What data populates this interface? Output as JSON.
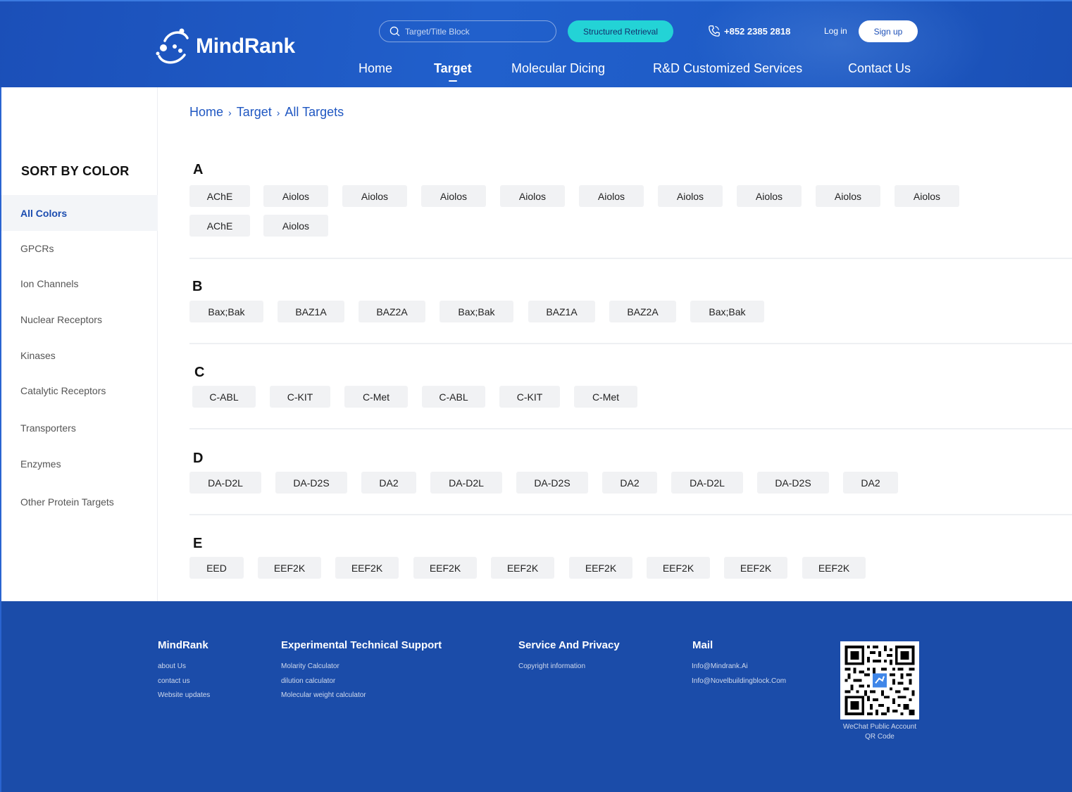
{
  "header": {
    "brand": "MindRank",
    "search_placeholder": "Target/Title Block",
    "retrieval_label": "Structured Retrieval",
    "phone": "+852 2385 2818",
    "login_label": "Log in",
    "signup_label": "Sign up",
    "nav": [
      "Home",
      "Target",
      "Molecular Dicing",
      "R&D Customized Services",
      "Contact Us"
    ],
    "active_nav": "Target"
  },
  "sidebar": {
    "title": "SORT BY COLOR",
    "categories": [
      "All Colors",
      "GPCRs",
      "Ion Channels",
      "Nuclear Receptors",
      "Kinases",
      "Catalytic Receptors",
      "Transporters",
      "Enzymes",
      "Other Protein Targets"
    ],
    "active": "All Colors"
  },
  "breadcrumb": [
    "Home",
    "Target",
    "All Targets"
  ],
  "groups": [
    {
      "letter": "A",
      "items": [
        "AChE",
        "Aiolos",
        "Aiolos",
        "Aiolos",
        "Aiolos",
        "Aiolos",
        "Aiolos",
        "Aiolos",
        "Aiolos",
        "Aiolos",
        "AChE",
        "Aiolos"
      ]
    },
    {
      "letter": "B",
      "items": [
        "Bax;Bak",
        "BAZ1A",
        "BAZ2A",
        "Bax;Bak",
        "BAZ1A",
        "BAZ2A",
        "Bax;Bak"
      ]
    },
    {
      "letter": "C",
      "items": [
        "C-ABL",
        "C-KIT",
        "C-Met",
        "C-ABL",
        "C-KIT",
        "C-Met"
      ]
    },
    {
      "letter": "D",
      "items": [
        "DA-D2L",
        "DA-D2S",
        "DA2",
        "DA-D2L",
        "DA-D2S",
        "DA2",
        "DA-D2L",
        "DA-D2S",
        "DA2"
      ]
    },
    {
      "letter": "E",
      "items": [
        "EED",
        "EEF2K",
        "EEF2K",
        "EEF2K",
        "EEF2K",
        "EEF2K",
        "EEF2K",
        "EEF2K",
        "EEF2K"
      ]
    }
  ],
  "footer": {
    "columns": [
      {
        "title": "MindRank",
        "links": [
          "about Us",
          "contact us",
          "Website updates"
        ]
      },
      {
        "title": "Experimental Technical Support",
        "links": [
          "Molarity Calculator",
          "dilution calculator",
          "Molecular weight calculator"
        ]
      },
      {
        "title": "Service And Privacy",
        "links": [
          "Copyright information"
        ]
      },
      {
        "title": "Mail",
        "links": [
          "Info@Mindrank.Ai",
          "Info@Novelbuildingblock.Com"
        ]
      }
    ],
    "qr_caption_line1": "WeChat Public Account",
    "qr_caption_line2": "QR Code"
  },
  "colors": {
    "brand_blue": "#1c4fb7",
    "footer_blue": "#1b4ca9",
    "accent_cyan": "#23d3d6",
    "chip_bg": "#f1f2f4"
  },
  "icons": {
    "search": "search-icon",
    "phone": "phone-icon",
    "logo": "mindrank-logo-icon",
    "qr": "qr-code-icon"
  }
}
